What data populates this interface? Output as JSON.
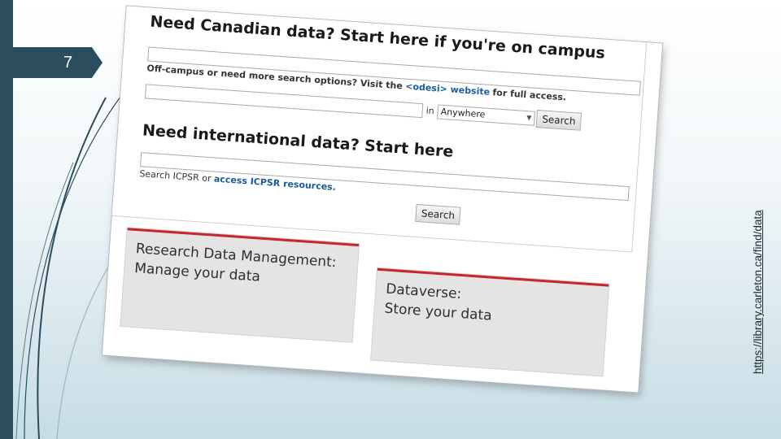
{
  "slide": {
    "number": "7",
    "side_link": "https://library.carleton.ca/find/data"
  },
  "screenshot": {
    "canadian": {
      "heading": "Need Canadian data? Start here if you're on campus",
      "search_value": "",
      "note_prefix": "Off-campus or need more search options? Visit the",
      "note_link": "<odesi> website",
      "note_suffix": "for full access.",
      "in_label": "in",
      "scope_selected": "Anywhere",
      "search_button": "Search"
    },
    "international": {
      "heading": "Need international data? Start here",
      "search_value": "",
      "note_prefix": "Search ICPSR or",
      "note_link": "access ICPSR resources.",
      "search_button": "Search"
    },
    "cards": [
      {
        "line1": "Research Data Management:",
        "line2": "Manage your data"
      },
      {
        "line1": "Dataverse:",
        "line2": "Store your data"
      }
    ]
  },
  "colors": {
    "sidebar": "#2a4d5e",
    "accent_rule": "#c7262e",
    "link": "#1b5c9e"
  }
}
